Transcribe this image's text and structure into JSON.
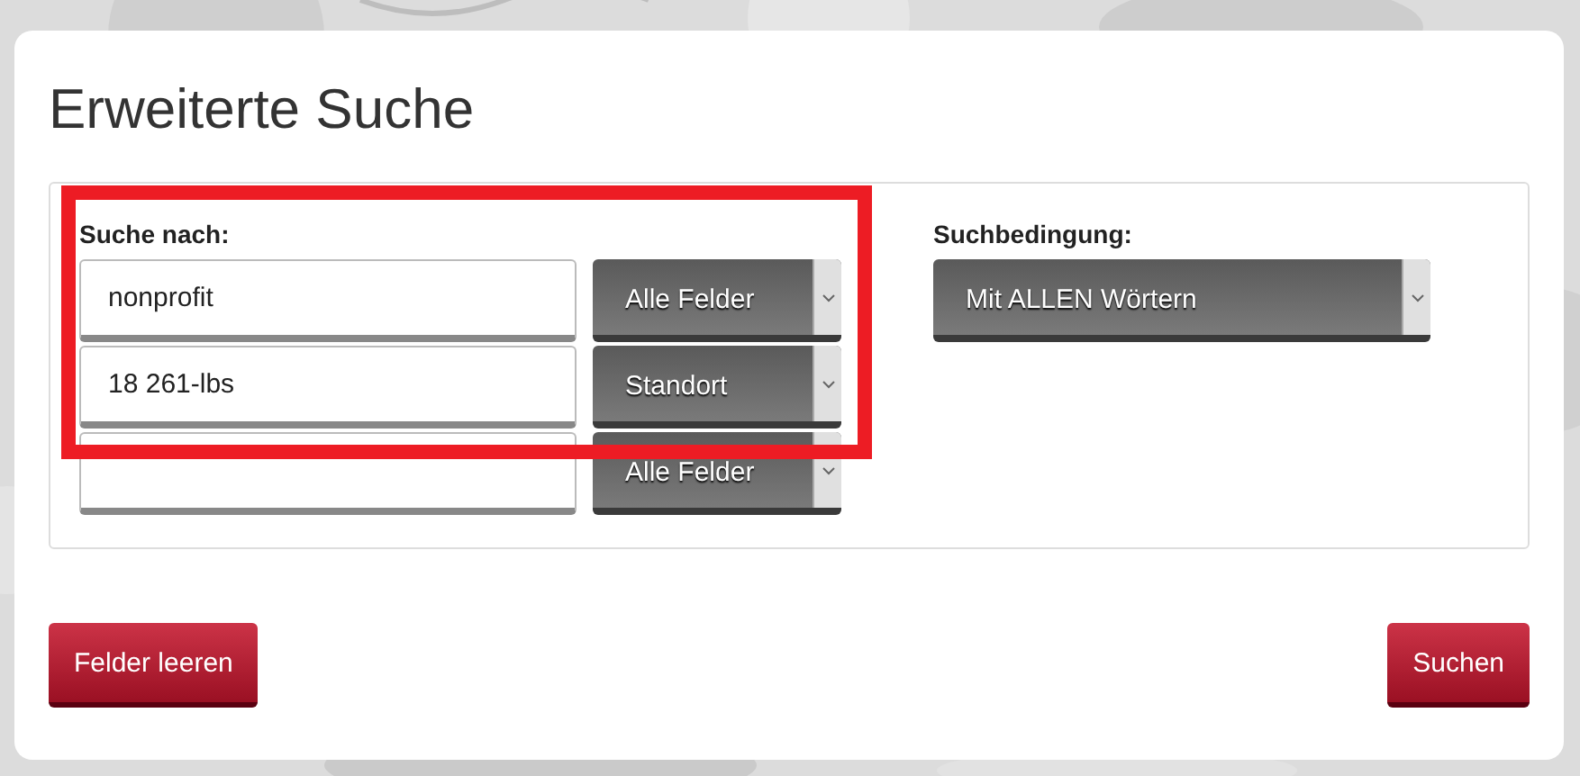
{
  "title": "Erweiterte Suche",
  "search_by": {
    "label": "Suche nach:",
    "rows": [
      {
        "value": "nonprofit",
        "field": "Alle Felder"
      },
      {
        "value": "18 261-lbs",
        "field": "Standort"
      },
      {
        "field": "Alle Felder"
      }
    ]
  },
  "condition": {
    "label": "Suchbedingung:",
    "value": "Mit ALLEN Wörtern"
  },
  "highlight_box": true,
  "buttons": [
    {
      "label": "Felder leeren",
      "kind": "reset"
    },
    {
      "label": "Suchen",
      "kind": "submit"
    }
  ]
}
